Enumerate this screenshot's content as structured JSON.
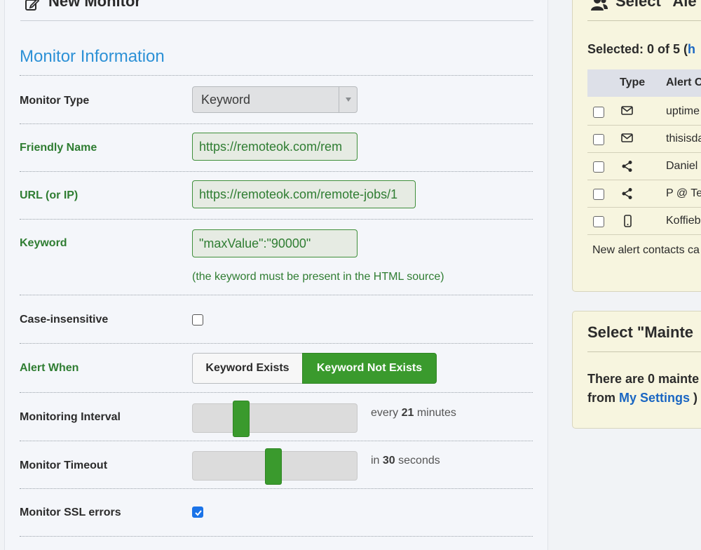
{
  "header": {
    "title": "New Monitor",
    "icon": "edit-icon"
  },
  "section": {
    "title": "Monitor Information"
  },
  "fields": {
    "monitor_type": {
      "label": "Monitor Type",
      "value": "Keyword"
    },
    "friendly_name": {
      "label": "Friendly Name",
      "value": "https://remoteok.com/rem"
    },
    "url": {
      "label": "URL (or IP)",
      "value": "https://remoteok.com/remote-jobs/1"
    },
    "keyword": {
      "label": "Keyword",
      "value": "\"maxValue\":\"90000\"",
      "hint": "(the keyword must be present in the HTML source)"
    },
    "case_insensitive": {
      "label": "Case-insensitive",
      "checked": false
    },
    "alert_when": {
      "label": "Alert When",
      "options": [
        "Keyword Exists",
        "Keyword Not Exists"
      ],
      "selected": "Keyword Not Exists"
    },
    "interval": {
      "label": "Monitoring Interval",
      "prefix": "every",
      "value": "21",
      "suffix": "minutes"
    },
    "timeout": {
      "label": "Monitor Timeout",
      "prefix": "in",
      "value": "30",
      "suffix": "seconds"
    },
    "ssl_errors": {
      "label": "Monitor SSL errors",
      "checked": true
    }
  },
  "alert_contacts": {
    "title": "Select \"Ale",
    "selected_text": "Selected: 0 of 5 (",
    "selected_link": "h",
    "columns": [
      "Type",
      "Alert C"
    ],
    "rows": [
      {
        "type_icon": "email-icon",
        "name": "uptime"
      },
      {
        "type_icon": "email-icon",
        "name": "thisisda"
      },
      {
        "type_icon": "share-icon",
        "name": "Daniel"
      },
      {
        "type_icon": "share-icon",
        "name": "P @ Te"
      },
      {
        "type_icon": "mobile-icon",
        "name": "Koffieb"
      }
    ],
    "note": "New alert contacts ca"
  },
  "maintenance": {
    "title": "Select \"Mainte",
    "line1": "There are 0 mainte",
    "line2_prefix": "from",
    "line2_link": "My Settings",
    "line2_suffix": ")"
  },
  "colors": {
    "accent_green": "#3a9a2d",
    "label_green": "#2f7d32",
    "section_blue": "#2d91d6",
    "link_blue": "#1a66c2"
  }
}
